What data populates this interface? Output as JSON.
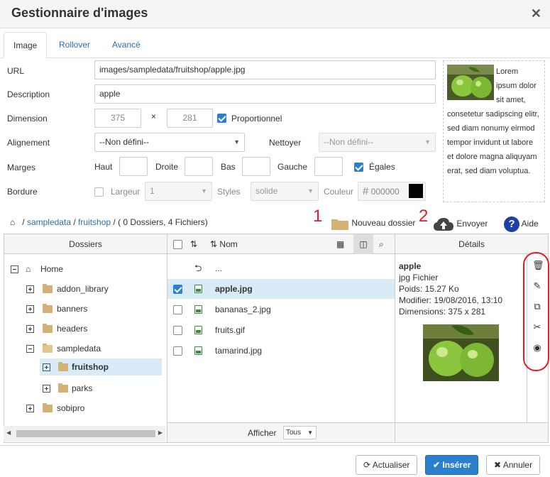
{
  "title": "Gestionnaire d'images",
  "tabs": [
    {
      "label": "Image",
      "active": true
    },
    {
      "label": "Rollover",
      "active": false
    },
    {
      "label": "Avancé",
      "active": false
    }
  ],
  "form": {
    "url_label": "URL",
    "url_value": "images/sampledata/fruitshop/apple.jpg",
    "description_label": "Description",
    "description_value": "apple",
    "dimension_label": "Dimension",
    "width": "375",
    "times": "×",
    "height": "281",
    "proportional_label": "Proportionnel",
    "proportional_checked": true,
    "alignment_label": "Alignement",
    "alignment_value": "--Non défini--",
    "clear_label": "Nettoyer",
    "clear_value": "--Non défini--",
    "margins_label": "Marges",
    "margin_top_label": "Haut",
    "margin_right_label": "Droite",
    "margin_bottom_label": "Bas",
    "margin_left_label": "Gauche",
    "equal_label": "Égales",
    "equal_checked": true,
    "border_label": "Bordure",
    "border_checked": false,
    "border_width_label": "Largeur",
    "border_width_value": "1",
    "border_style_label": "Styles",
    "border_style_value": "solide",
    "border_color_label": "Couleur",
    "border_color_value": "000000",
    "border_color_hex": "#000000"
  },
  "preview_text": "Lorem ipsum dolor sit amet, consetetur sadipscing elitr, sed diam nonumy eirmod tempor invidunt ut labore et dolore magna aliquyam erat, sed diam voluptua.",
  "breadcrumb": {
    "sep": "/",
    "path": [
      "sampledata",
      "fruitshop"
    ],
    "summary": "( 0 Dossiers, 4 Fichiers)"
  },
  "actions": {
    "marker1": "1",
    "new_folder": "Nouveau dossier",
    "marker2": "2",
    "upload": "Envoyer",
    "help": "Aide"
  },
  "panels": {
    "folders_title": "Dossiers",
    "name_col": "Nom",
    "details_title": "Détails",
    "show_label": "Afficher",
    "show_value": "Tous"
  },
  "tree": {
    "root": "Home",
    "items": [
      "addon_library",
      "banners",
      "headers",
      "sampledata",
      "fruitshop",
      "parks",
      "sobipro"
    ]
  },
  "files": {
    "up": "...",
    "items": [
      "apple.jpg",
      "bananas_2.jpg",
      "fruits.gif",
      "tamarind.jpg"
    ]
  },
  "details": {
    "name": "apple",
    "type": "jpg Fichier",
    "weight": "Poids: 15.27 Ko",
    "modified": "Modifier: 19/08/2016, 13:10",
    "dimensions": "Dimensions: 375 x 281"
  },
  "buttons": {
    "refresh": "Actualiser",
    "insert": "Insérer",
    "cancel": "Annuler"
  },
  "colors": {
    "primary": "#2b7fcf",
    "annotation": "#e31b23",
    "link": "#2a6fb5",
    "selected_row": "#d9ebf7"
  }
}
